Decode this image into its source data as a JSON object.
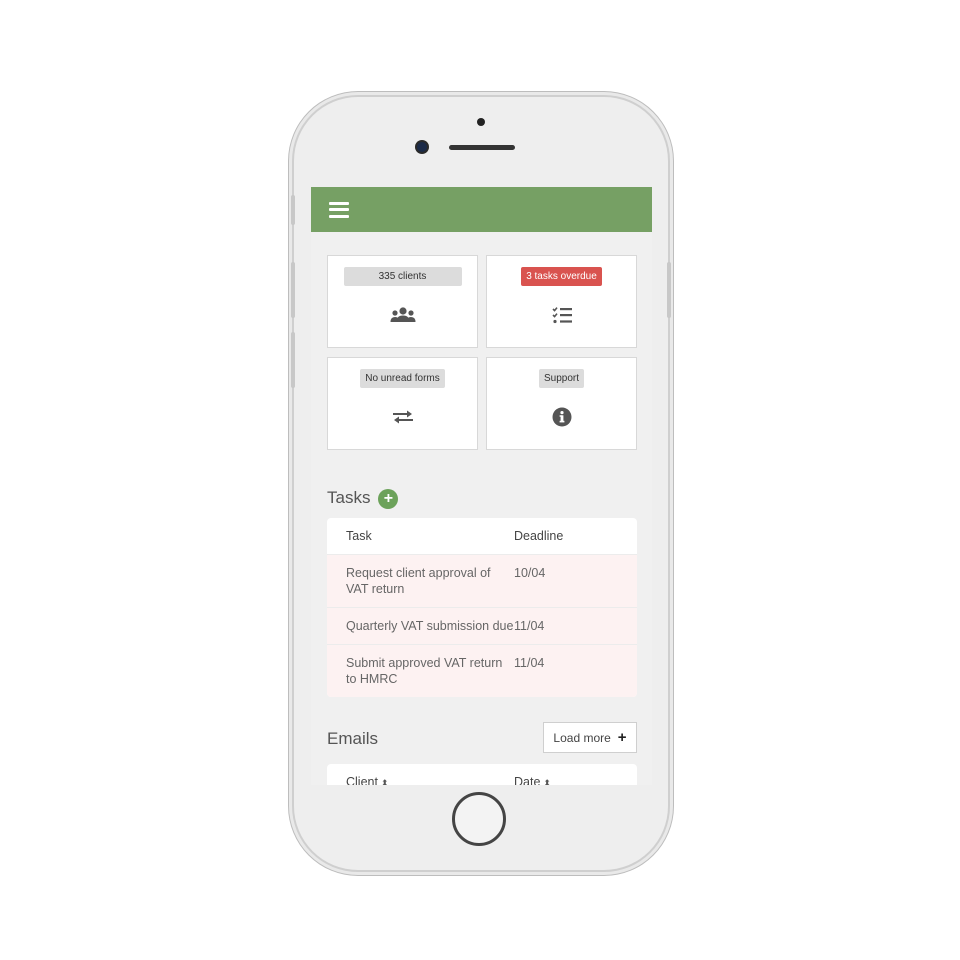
{
  "header": {
    "menu_icon": "hamburger-icon",
    "color": "#76a064"
  },
  "tiles": [
    {
      "badge": "335 clients",
      "icon": "users-icon",
      "badge_color": "#dcdcdc"
    },
    {
      "badge": "3 tasks overdue",
      "icon": "task-list-icon",
      "badge_color": "#d9534f"
    },
    {
      "badge": "No unread forms",
      "icon": "exchange-arrows-icon",
      "badge_color": "#dcdcdc"
    },
    {
      "badge": "Support",
      "icon": "info-icon",
      "badge_color": "#dcdcdc"
    }
  ],
  "tasks": {
    "title": "Tasks",
    "add_icon": "+",
    "columns": {
      "task": "Task",
      "deadline": "Deadline"
    },
    "rows": [
      {
        "task": "Request client approval of VAT return",
        "deadline": "10/04"
      },
      {
        "task": "Quarterly VAT submission due",
        "deadline": "11/04"
      },
      {
        "task": "Submit approved VAT return to HMRC",
        "deadline": "11/04"
      }
    ]
  },
  "emails": {
    "title": "Emails",
    "load_more": "Load more",
    "load_more_icon": "+",
    "columns": {
      "client": "Client",
      "date": "Date"
    },
    "sort_icon": "⬍"
  }
}
